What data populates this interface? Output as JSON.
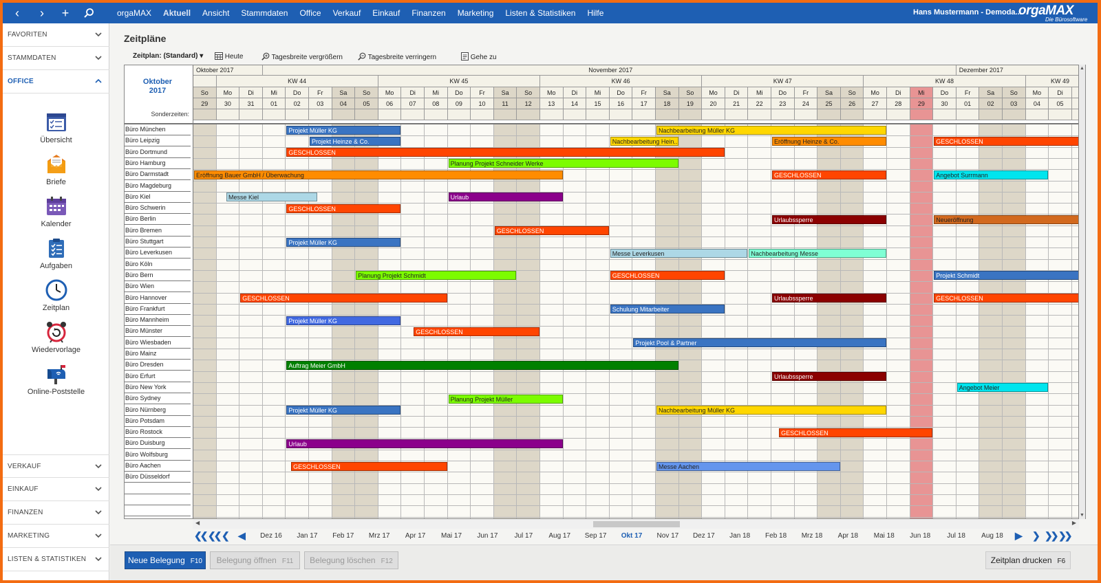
{
  "topbar": {
    "menu": [
      "orgaMAX",
      "Aktuell",
      "Ansicht",
      "Stammdaten",
      "Office",
      "Verkauf",
      "Einkauf",
      "Finanzen",
      "Marketing",
      "Listen & Statistiken",
      "Hilfe"
    ],
    "active_menu": "Aktuell",
    "user": "Hans Mustermann - Demoda...",
    "logo": "orgaMAX",
    "logo_sub": "Die Bürosoftware"
  },
  "sidebar": {
    "top_sections": [
      "FAVORITEN",
      "STAMMDATEN",
      "OFFICE"
    ],
    "open_section": "OFFICE",
    "office_items": [
      {
        "label": "Übersicht",
        "icon": "overview-icon"
      },
      {
        "label": "Briefe",
        "icon": "letter-icon"
      },
      {
        "label": "Kalender",
        "icon": "calendar-icon"
      },
      {
        "label": "Aufgaben",
        "icon": "tasks-icon"
      },
      {
        "label": "Zeitplan",
        "icon": "clock-icon"
      },
      {
        "label": "Wiedervorlage",
        "icon": "alarm-clock-icon"
      },
      {
        "label": "Online-Poststelle",
        "icon": "mailbox-icon"
      }
    ],
    "bottom_sections": [
      "VERKAUF",
      "EINKAUF",
      "FINANZEN",
      "MARKETING",
      "LISTEN & STATISTIKEN"
    ]
  },
  "page": {
    "title": "Zeitpläne",
    "toolbar": {
      "schedule": "Zeitplan: (Standard)",
      "today": "Heute",
      "zoom_in": "Tagesbreite vergrößern",
      "zoom_out": "Tagesbreite verringern",
      "goto": "Gehe zu"
    }
  },
  "schedule": {
    "corner_month": "Oktober",
    "corner_year": "2017",
    "special_label": "Sonderzeiten:",
    "months": [
      {
        "label": "Oktober 2017",
        "start": 0,
        "span": 3
      },
      {
        "label": "November 2017",
        "start": 3,
        "span": 30
      },
      {
        "label": "Dezember 2017",
        "start": 33,
        "span": 6
      }
    ],
    "weeks": [
      {
        "label": "KW 44",
        "start": 1,
        "span": 7
      },
      {
        "label": "KW 45",
        "start": 8,
        "span": 7
      },
      {
        "label": "KW 46",
        "start": 15,
        "span": 7
      },
      {
        "label": "KW 47",
        "start": 22,
        "span": 7
      },
      {
        "label": "KW 48",
        "start": 29,
        "span": 7
      },
      {
        "label": "KW 49",
        "start": 36,
        "span": 3
      }
    ],
    "weekdays": [
      "So",
      "Mo",
      "Di",
      "Mi",
      "Do",
      "Fr",
      "Sa",
      "So",
      "Mo",
      "Di",
      "Mi",
      "Do",
      "Fr",
      "Sa",
      "So",
      "Mo",
      "Di",
      "Mi",
      "Do",
      "Fr",
      "Sa",
      "So",
      "Mo",
      "Di",
      "Mi",
      "Do",
      "Fr",
      "Sa",
      "So",
      "Mo",
      "Di",
      "Mi",
      "Do",
      "Fr",
      "Sa",
      "So",
      "Mo",
      "Di",
      "Mi"
    ],
    "days": [
      "29",
      "30",
      "31",
      "01",
      "02",
      "03",
      "04",
      "05",
      "06",
      "07",
      "08",
      "09",
      "10",
      "11",
      "12",
      "13",
      "14",
      "15",
      "16",
      "17",
      "18",
      "19",
      "20",
      "21",
      "22",
      "23",
      "24",
      "25",
      "26",
      "27",
      "28",
      "29",
      "30",
      "01",
      "02",
      "03",
      "04",
      "05",
      "06"
    ],
    "today_index": 31,
    "rows": [
      "Büro München",
      "Büro Leipzig",
      "Büro Dortmund",
      "Büro Hamburg",
      "Büro Darmstadt",
      "Büro Magdeburg",
      "Büro Kiel",
      "Büro Schwerin",
      "Büro Berlin",
      "Büro Bremen",
      "Büro Stuttgart",
      "Büro Leverkusen",
      "Büro Köln",
      "Büro Bern",
      "Büro Wien",
      "Büro Hannover",
      "Büro Frankfurt",
      "Büro Mannheim",
      "Büro Münster",
      "Büro Wiesbaden",
      "Büro Mainz",
      "Büro Dresden",
      "Büro Erfurt",
      "Büro New York",
      "Büro Sydney",
      "Büro Nürnberg",
      "Büro Potsdam",
      "Büro Rostock",
      "Büro Duisburg",
      "Büro Wolfsburg",
      "Büro Aachen",
      "Büro Düsseldorf"
    ],
    "bookings": [
      {
        "row": 0,
        "start": 4,
        "end": 9,
        "label": "Projekt Müller KG",
        "color": "#3a74c2",
        "text": "#ffffff"
      },
      {
        "row": 0,
        "start": 20,
        "end": 30,
        "label": "Nachbearbeitung Müller KG",
        "color": "#ffd700",
        "text": "#222222"
      },
      {
        "row": 1,
        "start": 5,
        "end": 9,
        "label": "Projekt Heinze & Co.",
        "color": "#3a74c2",
        "text": "#ffffff"
      },
      {
        "row": 1,
        "start": 18,
        "end": 21,
        "label": "Nachbearbeitung Hein...",
        "color": "#ffd700",
        "text": "#222222"
      },
      {
        "row": 1,
        "start": 25,
        "end": 30,
        "label": "Eröffnung Heinze & Co.",
        "color": "#ff8c00",
        "text": "#222222"
      },
      {
        "row": 1,
        "start": 32,
        "end": 39,
        "label": "GESCHLOSSEN",
        "color": "#ff4500",
        "text": "#ffffff"
      },
      {
        "row": 2,
        "start": 4,
        "end": 23,
        "label": "GESCHLOSSEN",
        "color": "#ff4500",
        "text": "#ffffff"
      },
      {
        "row": 3,
        "start": 11,
        "end": 21,
        "label": "Planung Projekt Schneider Werke",
        "color": "#7cfc00",
        "text": "#222222"
      },
      {
        "row": 4,
        "start": 0,
        "end": 16,
        "label": "Eröffnung Bauer GmbH / Überwachung",
        "color": "#ff8c00",
        "text": "#222222"
      },
      {
        "row": 4,
        "start": 25,
        "end": 30,
        "label": "GESCHLOSSEN",
        "color": "#ff4500",
        "text": "#ffffff"
      },
      {
        "row": 4,
        "start": 32,
        "end": 37,
        "label": "Angebot Surrmann",
        "color": "#00e5ee",
        "text": "#222222"
      },
      {
        "row": 6,
        "start": 1.4,
        "end": 5.4,
        "label": "Messe Kiel",
        "color": "#add8e6",
        "text": "#222222"
      },
      {
        "row": 6,
        "start": 11,
        "end": 16,
        "label": "Urlaub",
        "color": "#8b008b",
        "text": "#ffffff"
      },
      {
        "row": 7,
        "start": 4,
        "end": 9,
        "label": "GESCHLOSSEN",
        "color": "#ff4500",
        "text": "#ffffff"
      },
      {
        "row": 8,
        "start": 25,
        "end": 30,
        "label": "Urlaubssperre",
        "color": "#8b0000",
        "text": "#ffffff"
      },
      {
        "row": 8,
        "start": 32,
        "end": 39,
        "label": "Neueröffnung",
        "color": "#d2691e",
        "text": "#222222"
      },
      {
        "row": 9,
        "start": 13,
        "end": 18,
        "label": "GESCHLOSSEN",
        "color": "#ff4500",
        "text": "#ffffff"
      },
      {
        "row": 10,
        "start": 4,
        "end": 9,
        "label": "Projekt Müller KG",
        "color": "#3a74c2",
        "text": "#ffffff"
      },
      {
        "row": 11,
        "start": 18,
        "end": 24,
        "label": "Messe Leverkusen",
        "color": "#add8e6",
        "text": "#222222"
      },
      {
        "row": 11,
        "start": 24,
        "end": 30,
        "label": "Nachbearbeitung Messe",
        "color": "#7fffd4",
        "text": "#222222"
      },
      {
        "row": 13,
        "start": 7,
        "end": 14,
        "label": "Planung Projekt Schmidt",
        "color": "#7cfc00",
        "text": "#222222"
      },
      {
        "row": 13,
        "start": 18,
        "end": 23,
        "label": "GESCHLOSSEN",
        "color": "#ff4500",
        "text": "#ffffff"
      },
      {
        "row": 13,
        "start": 32,
        "end": 39,
        "label": "Projekt Schmidt",
        "color": "#3a74c2",
        "text": "#ffffff"
      },
      {
        "row": 15,
        "start": 2,
        "end": 11,
        "label": "GESCHLOSSEN",
        "color": "#ff4500",
        "text": "#ffffff"
      },
      {
        "row": 15,
        "start": 25,
        "end": 30,
        "label": "Urlaubssperre",
        "color": "#8b0000",
        "text": "#ffffff"
      },
      {
        "row": 15,
        "start": 32,
        "end": 39,
        "label": "GESCHLOSSEN",
        "color": "#ff4500",
        "text": "#ffffff"
      },
      {
        "row": 16,
        "start": 18,
        "end": 23,
        "label": "Schulung Mitarbeiter",
        "color": "#3a74c2",
        "text": "#ffffff"
      },
      {
        "row": 17,
        "start": 4,
        "end": 9,
        "label": "Projekt Müller KG",
        "color": "#4169e1",
        "text": "#ffffff"
      },
      {
        "row": 18,
        "start": 9.5,
        "end": 15,
        "label": "GESCHLOSSEN",
        "color": "#ff4500",
        "text": "#ffffff"
      },
      {
        "row": 19,
        "start": 19,
        "end": 30,
        "label": "Projekt Pool & Partner",
        "color": "#3a74c2",
        "text": "#ffffff"
      },
      {
        "row": 21,
        "start": 4,
        "end": 21,
        "label": "Auftrag Meier GmbH",
        "color": "#008000",
        "text": "#ffffff"
      },
      {
        "row": 22,
        "start": 25,
        "end": 30,
        "label": "Urlaubssperre",
        "color": "#8b0000",
        "text": "#ffffff"
      },
      {
        "row": 23,
        "start": 33,
        "end": 37,
        "label": "Angebot Meier",
        "color": "#00e5ee",
        "text": "#222222"
      },
      {
        "row": 24,
        "start": 11,
        "end": 16,
        "label": "Planung Projekt Müller",
        "color": "#7cfc00",
        "text": "#222222"
      },
      {
        "row": 25,
        "start": 4,
        "end": 9,
        "label": "Projekt Müller KG",
        "color": "#3a74c2",
        "text": "#ffffff"
      },
      {
        "row": 25,
        "start": 20,
        "end": 30,
        "label": "Nachbearbeitung Müller KG",
        "color": "#ffd700",
        "text": "#222222"
      },
      {
        "row": 27,
        "start": 25.3,
        "end": 32,
        "label": "GESCHLOSSEN",
        "color": "#ff4500",
        "text": "#ffffff"
      },
      {
        "row": 28,
        "start": 4,
        "end": 16,
        "label": "Urlaub",
        "color": "#8b008b",
        "text": "#ffffff"
      },
      {
        "row": 30,
        "start": 4.2,
        "end": 11,
        "label": "GESCHLOSSEN",
        "color": "#ff4500",
        "text": "#ffffff"
      },
      {
        "row": 30,
        "start": 20,
        "end": 28,
        "label": "Messe Aachen",
        "color": "#6495ed",
        "text": "#222222"
      }
    ]
  },
  "month_nav": {
    "months": [
      "Dez 16",
      "Jan 17",
      "Feb 17",
      "Mrz 17",
      "Apr 17",
      "Mai 17",
      "Jun 17",
      "Jul 17",
      "Aug 17",
      "Sep 17",
      "Okt 17",
      "Nov 17",
      "Dez 17",
      "Jan 18",
      "Feb 18",
      "Mrz 18",
      "Apr 18",
      "Mai 18",
      "Jun 18",
      "Jul 18",
      "Aug 18"
    ],
    "current": "Okt 17"
  },
  "footer": {
    "new_booking": "Neue Belegung",
    "new_key": "F10",
    "open_booking": "Belegung öffnen",
    "open_key": "F11",
    "delete_booking": "Belegung löschen",
    "delete_key": "F12",
    "print": "Zeitplan drucken",
    "print_key": "F6"
  },
  "colors": {
    "accent": "#1e5fb3",
    "frame": "#f36c12",
    "weekend": "#ddd7c8",
    "today": "#e89494",
    "cell": "#fbfaf5"
  }
}
